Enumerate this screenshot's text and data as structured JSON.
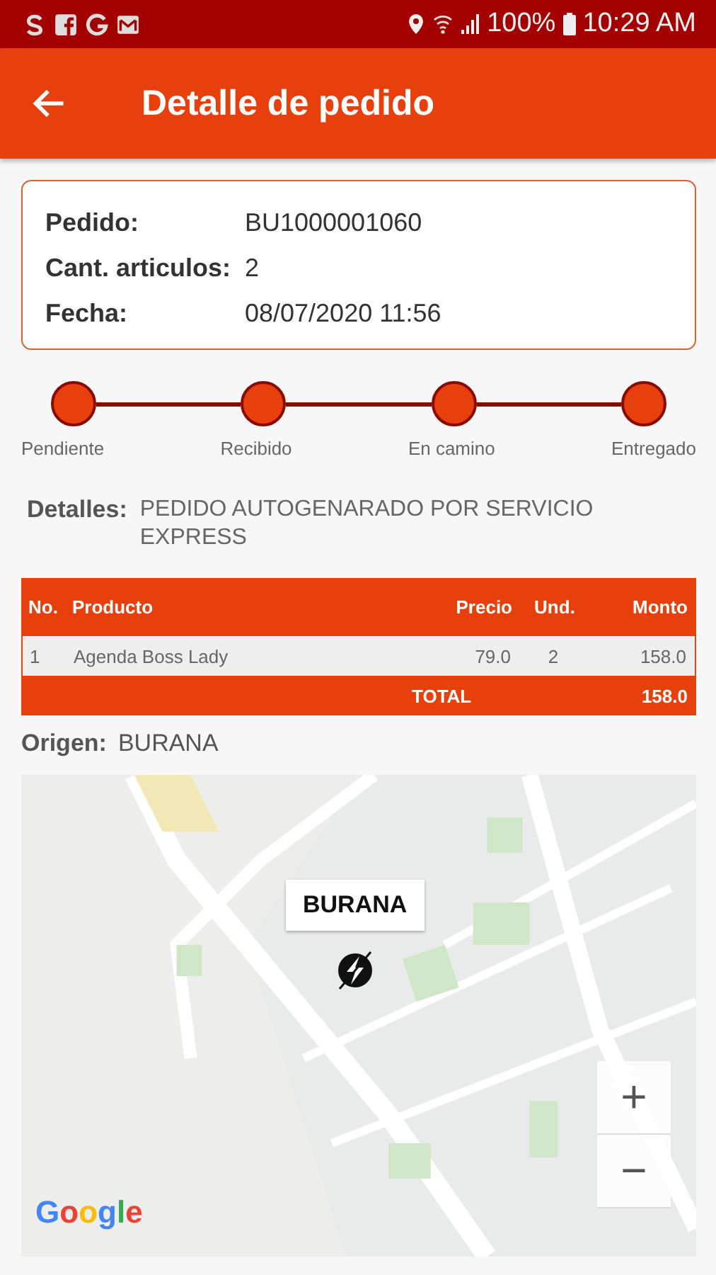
{
  "status_bar": {
    "notifications": [
      {
        "kind": "s"
      },
      {
        "kind": "facebook"
      },
      {
        "kind": "g"
      },
      {
        "kind": "mail"
      }
    ],
    "battery": "100%",
    "time": "10:29 AM"
  },
  "app_bar": {
    "title": "Detalle de pedido"
  },
  "order": {
    "fields": [
      {
        "label": "Pedido:",
        "value": "BU1000001060"
      },
      {
        "label": "Cant. articulos:",
        "value": "2"
      },
      {
        "label": "Fecha:",
        "value": "08/07/2020 11:56"
      }
    ]
  },
  "steps": [
    {
      "label": "Pendiente",
      "done": true
    },
    {
      "label": "Recibido",
      "done": true
    },
    {
      "label": "En camino",
      "done": true
    },
    {
      "label": "Entregado",
      "done": true
    }
  ],
  "details": {
    "label": "Detalles:",
    "text": "PEDIDO AUTOGENARADO POR SERVICIO EXPRESS"
  },
  "table": {
    "columns": [
      "No.",
      "Producto",
      "Precio",
      "Und.",
      "Monto"
    ],
    "rows": [
      [
        "1",
        "Agenda Boss Lady",
        "79.0",
        "2",
        "158.0"
      ]
    ],
    "total": {
      "label": "TOTAL",
      "value": "158.0"
    }
  },
  "origin": {
    "label": "Origen:",
    "value": "BURANA"
  },
  "map": {
    "kind": "picture",
    "marker_title": "BURANA",
    "zoom_in": "+",
    "zoom_out": "−",
    "attribution": "Google"
  }
}
